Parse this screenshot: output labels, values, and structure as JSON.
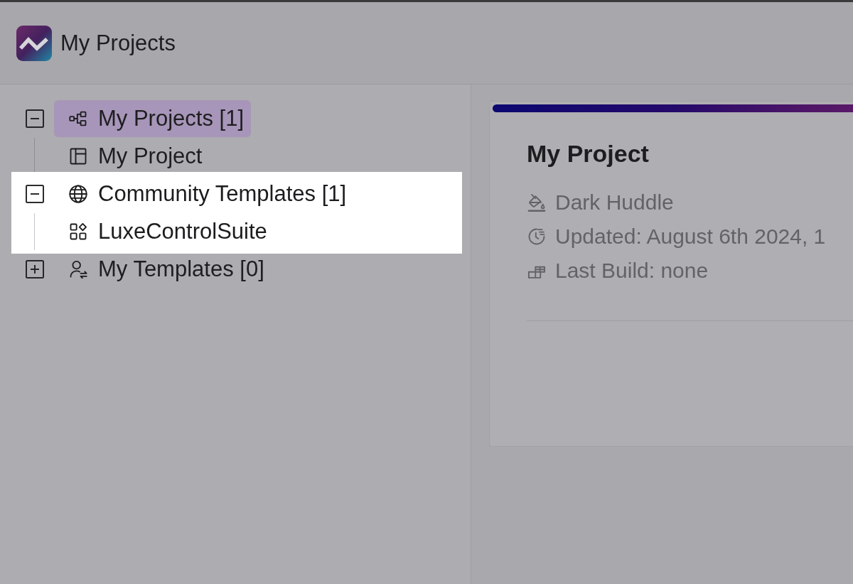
{
  "header": {
    "title": "My Projects"
  },
  "tree": [
    {
      "label": "My Projects [1]",
      "expanded": true,
      "selected": true,
      "spotlight": false,
      "children": [
        {
          "label": "My Project",
          "selected": false
        }
      ]
    },
    {
      "label": "Community Templates [1]",
      "expanded": true,
      "selected": false,
      "spotlight": true,
      "children": [
        {
          "label": "LuxeControlSuite",
          "selected": false
        }
      ]
    },
    {
      "label": "My Templates [0]",
      "expanded": false,
      "selected": false,
      "spotlight": false
    }
  ],
  "project_card": {
    "title": "My Project",
    "details": [
      "Dark Huddle",
      "Updated: August 6th 2024, 1",
      "Last Build: none"
    ]
  }
}
